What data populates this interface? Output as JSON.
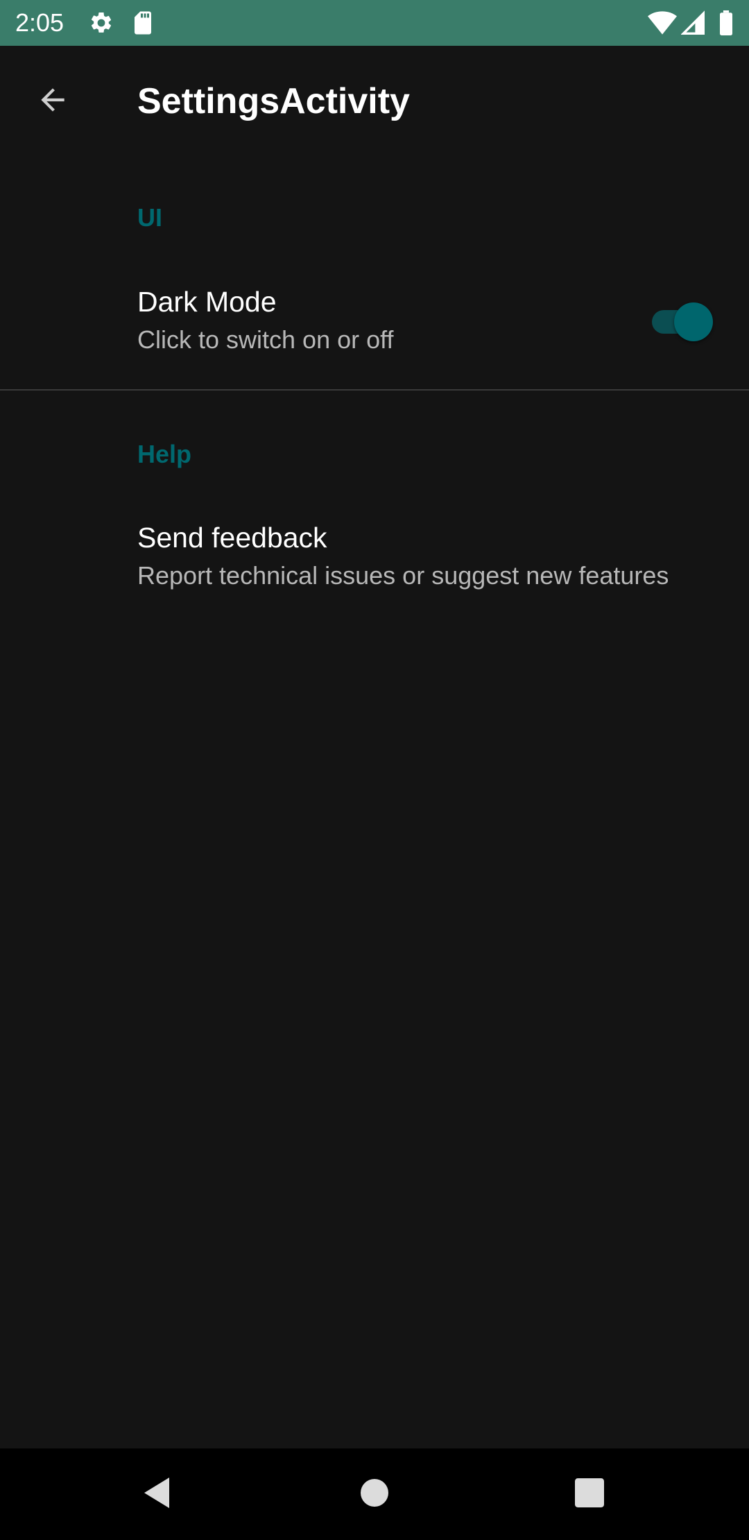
{
  "status_bar": {
    "time": "2:05",
    "icons": [
      "gear-icon",
      "sd-card-icon",
      "wifi-icon",
      "signal-icon",
      "battery-icon"
    ],
    "background": "#3a7d6a"
  },
  "app_bar": {
    "title": "SettingsActivity",
    "back_icon": "arrow-back-icon"
  },
  "categories": [
    {
      "title": "UI",
      "items": [
        {
          "title": "Dark Mode",
          "summary": "Click to switch on or off",
          "switch_on": true
        }
      ]
    },
    {
      "title": "Help",
      "items": [
        {
          "title": "Send feedback",
          "summary": "Report technical issues or suggest new features"
        }
      ]
    }
  ],
  "nav_bar": {
    "buttons": [
      "back-triangle-icon",
      "home-circle-icon",
      "recents-square-icon"
    ]
  },
  "colors": {
    "background": "#141414",
    "accent": "#00686f",
    "text_primary": "#ffffff",
    "text_secondary": "#b8b8b8"
  }
}
